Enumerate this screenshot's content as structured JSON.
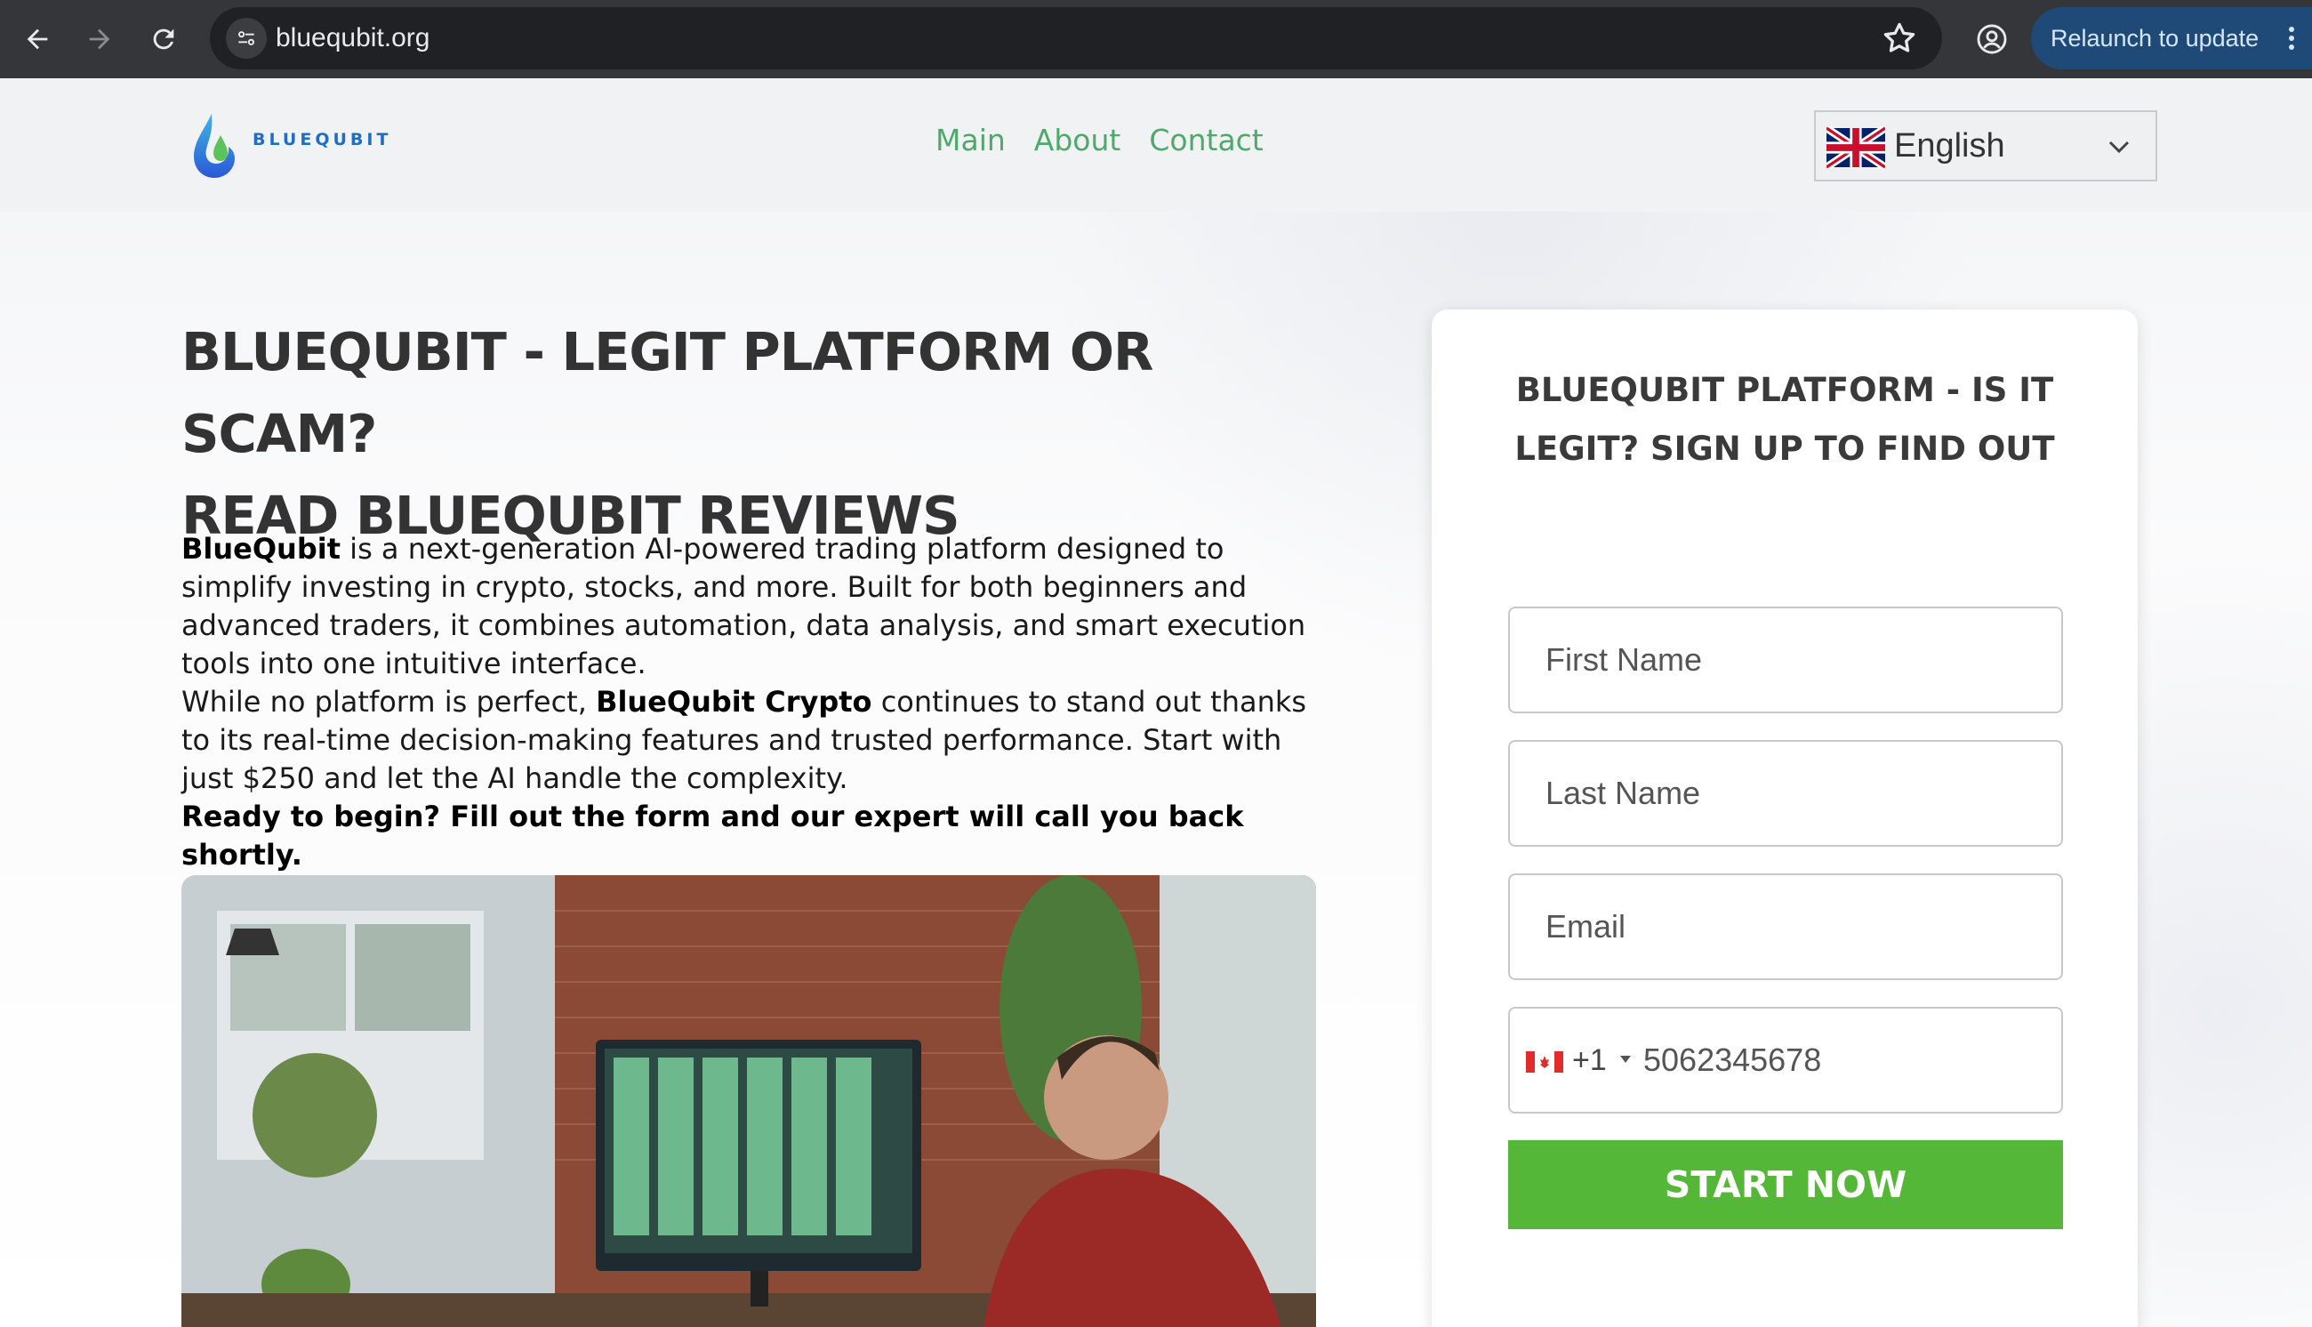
{
  "browser": {
    "url": "bluequbit.org",
    "relaunch_label": "Relaunch to update"
  },
  "header": {
    "logo_text": "BLUEQUBIT",
    "menu": [
      {
        "label": "Main"
      },
      {
        "label": "About"
      },
      {
        "label": "Contact"
      }
    ],
    "language": "English"
  },
  "main": {
    "headline_line1": "BLUEQUBIT - LEGIT PLATFORM OR SCAM?",
    "headline_line2": "READ BLUEQUBIT REVIEWS",
    "p1_strong": "BlueQubit",
    "p1_rest": " is a next-generation AI-powered trading platform designed to simplify investing in crypto, stocks, and more. Built for both beginners and advanced traders, it combines automation, data analysis, and smart execution tools into one intuitive interface.",
    "p2_start": "While no platform is perfect, ",
    "p2_strong": "BlueQubit Crypto",
    "p2_rest": " continues to stand out thanks to its real-time decision-making features and trusted performance. Start with just $250 and let the AI handle the complexity.",
    "p3_strong": "Ready to begin? Fill out the form and our expert will call you back shortly."
  },
  "form": {
    "title_line1": "BLUEQUBIT PLATFORM - IS IT",
    "title_line2": "LEGIT? SIGN UP TO FIND OUT",
    "first_name_placeholder": "First Name",
    "last_name_placeholder": "Last Name",
    "email_placeholder": "Email",
    "dial_code": "+1",
    "phone_value": "5062345678",
    "submit_label": "START NOW"
  },
  "colors": {
    "menu_green": "#4ea96b",
    "button_green": "#55b737",
    "logo_blue": "#1f6ec5",
    "chrome_dark": "#35363a",
    "relaunch_blue": "#1f4a78"
  },
  "icons": [
    "back-arrow-icon",
    "forward-arrow-icon",
    "reload-icon",
    "site-info-icon",
    "bookmark-star-icon",
    "profile-icon",
    "kebab-menu-icon",
    "uk-flag-icon",
    "chevron-down-icon",
    "canada-flag-icon",
    "dropdown-triangle-icon"
  ]
}
